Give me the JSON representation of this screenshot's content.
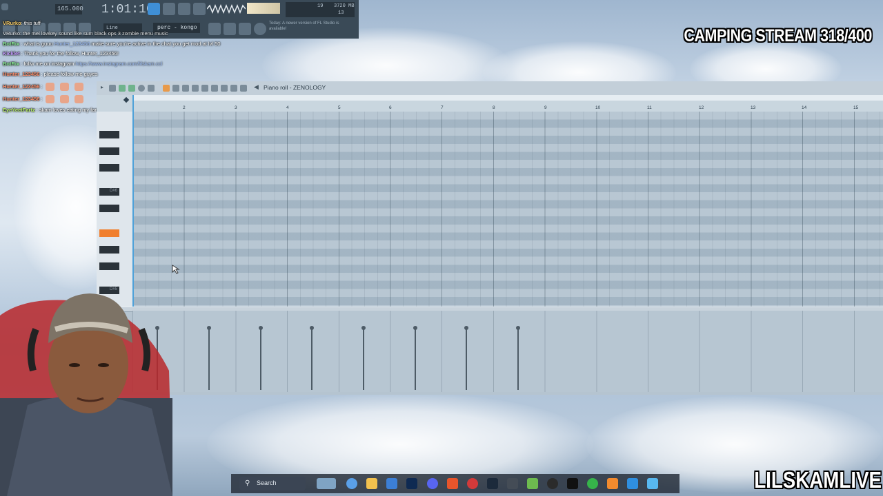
{
  "fl_toolbar": {
    "tempo": "165.000",
    "time": "1:01:16",
    "pattern": "perc - kongo",
    "snap": "Line",
    "cpu": "19",
    "memory": "3720 MB",
    "polyphony": "13",
    "update_notice": "Today: A newer version of FL Studio is available!",
    "hint_line": "VRurko: the mel lowkey sound like sum black ops 3 zombie menu music"
  },
  "chat": [
    {
      "user": "VRurko",
      "message": "this tuff",
      "color": "#ffd36b"
    },
    {
      "user": "BotRix",
      "message": "what is guuu",
      "extra": "Hunter_123456",
      "tail": "make sure you're active in the chat you get mod at lvl 50",
      "color": "#8ef09a"
    },
    {
      "user": "Kicklet",
      "message": "Thank you for the follow, Hunter_123456!",
      "color": "#c49bff"
    },
    {
      "user": "BotRix",
      "message": "follw me on instagram",
      "link": "https://www.instagram.com/lilskam.ccl",
      "color": "#8ef09a"
    },
    {
      "user": "Hunter_123456",
      "message": "please follow me guyes",
      "color": "#ff8f6b"
    },
    {
      "user": "Hunter_123456",
      "message": "",
      "color": "#ff8f6b"
    },
    {
      "user": "Hunter_123456",
      "message": "",
      "color": "#ff8f6b"
    },
    {
      "user": "EyeYeetFartz",
      "message": "skam loves eating my farts",
      "color": "#b9f06b"
    }
  ],
  "overlay": {
    "stream_title": "CAMPING STREAM 318/400",
    "channel_name": "LILSKAMLIVE"
  },
  "piano_roll": {
    "title": "Piano roll - ZENOLOGY",
    "bars": [
      "2",
      "3",
      "4",
      "5",
      "6",
      "7",
      "8",
      "9",
      "10",
      "11",
      "12",
      "13",
      "14",
      "15"
    ],
    "key_labels": {
      "d6": "D#6",
      "d5": "D#5"
    },
    "highlight_key_color": "#f07f2e",
    "velocity_bar_count": 8
  },
  "taskbar": {
    "search_label": "Search",
    "icons": [
      "file-explorer-icon",
      "copilot-icon",
      "folder-icon",
      "store-icon",
      "photoshop-icon",
      "discord-icon",
      "brave-icon",
      "browser-icon",
      "steam-icon",
      "app-icon",
      "obs-icon",
      "capcut-icon",
      "green-app-icon",
      "fl-studio-icon",
      "paint-icon",
      "notepad-icon"
    ]
  }
}
